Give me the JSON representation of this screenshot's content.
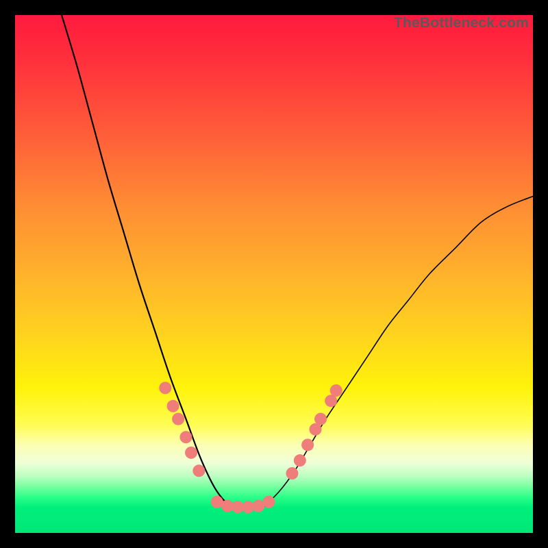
{
  "watermark": "TheBottleneck.com",
  "colors": {
    "background": "#000000",
    "gradient_top": "#ff1a3e",
    "gradient_bottom": "#00e676",
    "curve": "#000000",
    "beads": "#ef7d7a"
  },
  "chart_data": {
    "type": "line",
    "title": "",
    "xlabel": "",
    "ylabel": "",
    "xlim": [
      0,
      100
    ],
    "ylim": [
      0,
      100
    ],
    "note": "Axes are unlabeled in the original image. Values are estimated normalized coordinates (0–100) read from pixel positions; y=0 is bottom (green), y=100 is top (red). Two curve arms share a flat trough near y≈5 around x≈37–48.",
    "series": [
      {
        "name": "left-arm",
        "x": [
          9,
          12,
          15,
          18,
          21,
          24,
          27,
          30,
          33,
          36,
          39,
          42,
          45,
          48
        ],
        "y": [
          100,
          90,
          79,
          68,
          58,
          48,
          39,
          30,
          22,
          14,
          8,
          5,
          5,
          5
        ]
      },
      {
        "name": "right-arm",
        "x": [
          48,
          51,
          54,
          57,
          60,
          64,
          68,
          72,
          76,
          80,
          85,
          90,
          95,
          100
        ],
        "y": [
          5,
          8,
          12,
          17,
          22,
          28,
          34,
          40,
          45,
          50,
          55,
          60,
          63,
          65
        ]
      }
    ],
    "markers": {
      "name": "highlight-beads",
      "points": [
        {
          "x": 29.0,
          "y": 28.0
        },
        {
          "x": 30.5,
          "y": 24.5
        },
        {
          "x": 31.5,
          "y": 22.0
        },
        {
          "x": 33.0,
          "y": 18.5
        },
        {
          "x": 34.0,
          "y": 15.5
        },
        {
          "x": 35.5,
          "y": 12.0
        },
        {
          "x": 39.0,
          "y": 6.0
        },
        {
          "x": 41.0,
          "y": 5.2
        },
        {
          "x": 43.0,
          "y": 5.0
        },
        {
          "x": 45.0,
          "y": 5.0
        },
        {
          "x": 47.0,
          "y": 5.2
        },
        {
          "x": 49.0,
          "y": 6.0
        },
        {
          "x": 53.5,
          "y": 11.5
        },
        {
          "x": 55.0,
          "y": 14.0
        },
        {
          "x": 56.5,
          "y": 17.0
        },
        {
          "x": 58.0,
          "y": 20.0
        },
        {
          "x": 59.0,
          "y": 22.0
        },
        {
          "x": 61.0,
          "y": 25.5
        },
        {
          "x": 62.0,
          "y": 27.5
        }
      ],
      "radius_px": 9
    }
  }
}
